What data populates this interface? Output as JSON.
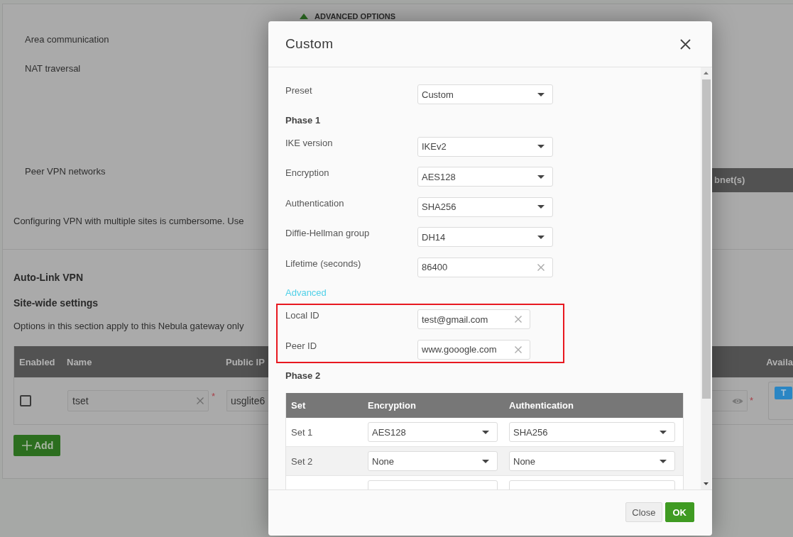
{
  "background": {
    "advanced_options": {
      "label": "ADVANCED OPTIONS",
      "expanded": true
    },
    "settings": [
      {
        "label": "Area communication"
      },
      {
        "label": "NAT traversal"
      },
      {
        "label": "Peer VPN networks"
      }
    ],
    "peer_networks_table": {
      "column_label": "bnet(s)"
    },
    "note": "Configuring VPN with multiple sites is cumbersome. Use",
    "auto_link": {
      "title": "Auto-Link VPN",
      "subtitle": "Site-wide settings",
      "description": "Options in this section apply to this Nebula gateway only",
      "table": {
        "columns": [
          {
            "label": "Enabled"
          },
          {
            "label": "Name"
          },
          {
            "label": "Public IP"
          },
          {
            "label": "Availa"
          }
        ],
        "rows": [
          {
            "enabled": false,
            "name": "tset",
            "name_required_mark": "*",
            "public_ip": "usglite6",
            "column_4_required_mark": "*",
            "column_5_badge": "T"
          }
        ]
      },
      "add_button": {
        "label": "Add"
      }
    }
  },
  "dialog": {
    "title": "Custom",
    "fields": [
      {
        "kind": "select",
        "label": "Preset",
        "value": "Custom"
      },
      {
        "kind": "heading",
        "label": "Phase 1"
      },
      {
        "kind": "select",
        "label": "IKE version",
        "value": "IKEv2"
      },
      {
        "kind": "select",
        "label": "Encryption",
        "value": "AES128"
      },
      {
        "kind": "select",
        "label": "Authentication",
        "value": "SHA256"
      },
      {
        "kind": "select",
        "label": "Diffie-Hellman group",
        "value": "DH14"
      },
      {
        "kind": "text",
        "label": "Lifetime (seconds)",
        "value": "86400"
      },
      {
        "kind": "link",
        "label": "Advanced"
      },
      {
        "kind": "group",
        "highlighted": true,
        "fields": [
          {
            "kind": "text",
            "label": "Local ID",
            "value": "test@gmail.com"
          },
          {
            "kind": "text",
            "label": "Peer ID",
            "value": "www.gooogle.com"
          }
        ]
      },
      {
        "kind": "heading",
        "label": "Phase 2"
      }
    ],
    "phase2_table": {
      "columns": [
        {
          "label": "Set"
        },
        {
          "label": "Encryption"
        },
        {
          "label": "Authentication"
        }
      ],
      "rows": [
        {
          "kind": "full",
          "set": "Set 1",
          "encryption": "AES128",
          "authentication": "SHA256"
        },
        {
          "kind": "full",
          "set": "Set 2",
          "encryption": "None",
          "authentication": "None"
        },
        {
          "kind": "clipped"
        }
      ]
    },
    "buttons": [
      {
        "kind": "secondary",
        "label": "Close"
      },
      {
        "kind": "primary",
        "label": "OK"
      }
    ]
  }
}
